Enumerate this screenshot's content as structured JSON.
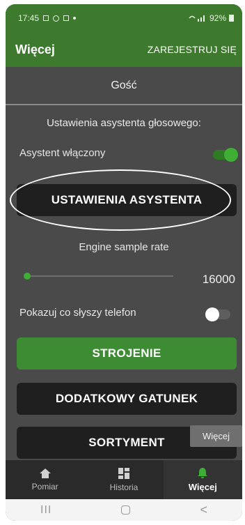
{
  "status_bar": {
    "time": "17:45",
    "battery": "92%"
  },
  "app_bar": {
    "title": "Więcej",
    "action": "ZAREJESTRUJ SIĘ"
  },
  "user": {
    "name": "Gość"
  },
  "voice_settings": {
    "section_title": "Ustawienia asystenta głosowego:",
    "assistant_label": "Asystent włączony",
    "assistant_enabled": true,
    "settings_button": "USTAWIENIA ASYSTENTA"
  },
  "engine": {
    "label": "Engine sample rate",
    "value": "16000"
  },
  "hearing": {
    "label": "Pokazuj co słyszy telefon",
    "enabled": false
  },
  "buttons": {
    "tuning": "STROJENIE",
    "extra_species": "DODATKOWY GATUNEK",
    "assortment": "SORTYMENT"
  },
  "tooltip": "Więcej",
  "bottom_nav": {
    "items": [
      {
        "label": "Pomiar",
        "icon": "home-icon"
      },
      {
        "label": "Historia",
        "icon": "grid-icon"
      },
      {
        "label": "Więcej",
        "icon": "bell-icon",
        "active": true
      }
    ]
  },
  "system_nav": {
    "recent": "III",
    "back": "<"
  },
  "colors": {
    "accent": "#3d7a2e",
    "background": "#4a4a4a",
    "button": "#1f1f1f",
    "primary_button": "#3d8c34"
  }
}
